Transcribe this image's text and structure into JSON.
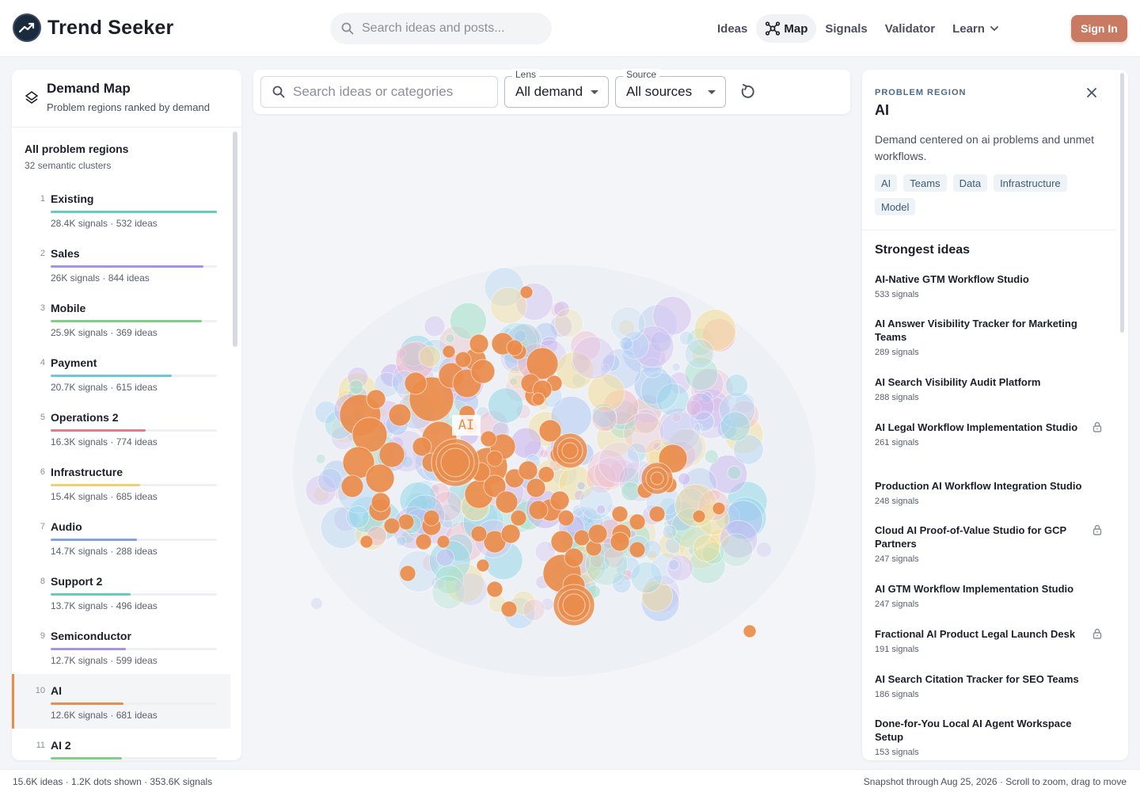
{
  "app": {
    "title": "Trend Seeker"
  },
  "header": {
    "search_placeholder": "Search ideas and posts...",
    "nav": [
      {
        "label": "Ideas",
        "active": false
      },
      {
        "label": "Map",
        "active": true,
        "icon": "graph-nodes-icon"
      },
      {
        "label": "Signals",
        "active": false
      },
      {
        "label": "Validator",
        "active": false
      },
      {
        "label": "Learn",
        "active": false,
        "icon": "chevron-down-icon"
      }
    ],
    "sign_in": "Sign In",
    "accent": "#c97a62"
  },
  "left_panel": {
    "title": "Demand Map",
    "subtitle": "Problem regions ranked by demand",
    "all_title": "All problem regions",
    "all_sub": "32 semantic clusters",
    "items": [
      {
        "rank": "1",
        "name": "Existing",
        "meta": "28.4K signals · 532 ideas",
        "bar": 1.0,
        "color": "#66cdb8",
        "active": false
      },
      {
        "rank": "2",
        "name": "Sales",
        "meta": "26K signals · 844 ideas",
        "bar": 0.92,
        "color": "#a793e0",
        "active": false
      },
      {
        "rank": "3",
        "name": "Mobile",
        "meta": "25.9K signals · 369 ideas",
        "bar": 0.91,
        "color": "#7fcf8a",
        "active": false
      },
      {
        "rank": "4",
        "name": "Payment",
        "meta": "20.7K signals · 615 ideas",
        "bar": 0.73,
        "color": "#6ec8d8",
        "active": false
      },
      {
        "rank": "5",
        "name": "Operations 2",
        "meta": "16.3K signals · 774 ideas",
        "bar": 0.57,
        "color": "#dc7f86",
        "active": false
      },
      {
        "rank": "6",
        "name": "Infrastructure",
        "meta": "15.4K signals · 685 ideas",
        "bar": 0.54,
        "color": "#f0d16a",
        "active": false
      },
      {
        "rank": "7",
        "name": "Audio",
        "meta": "14.7K signals · 288 ideas",
        "bar": 0.52,
        "color": "#7fa2e6",
        "active": false
      },
      {
        "rank": "8",
        "name": "Support 2",
        "meta": "13.7K signals · 496 ideas",
        "bar": 0.48,
        "color": "#66cdb8",
        "active": false
      },
      {
        "rank": "9",
        "name": "Semiconductor",
        "meta": "12.7K signals · 599 ideas",
        "bar": 0.45,
        "color": "#a793e0",
        "active": false
      },
      {
        "rank": "10",
        "name": "AI",
        "meta": "12.6K signals · 681 ideas",
        "bar": 0.44,
        "color": "#ea8c4b",
        "active": true
      },
      {
        "rank": "11",
        "name": "AI 2",
        "meta": "",
        "bar": 0.43,
        "color": "#7fcf8a",
        "active": false
      }
    ]
  },
  "toolbar": {
    "search_placeholder": "Search ideas or categories",
    "lens_label": "Lens",
    "lens_value": "All demand",
    "source_label": "Source",
    "source_value": "All sources"
  },
  "map": {
    "region_label": "AI",
    "highlight_color": "#ea8c4b"
  },
  "right_panel": {
    "eyebrow": "PROBLEM REGION",
    "title": "AI",
    "description": "Demand centered on ai problems and unmet workflows.",
    "tags": [
      "AI",
      "Teams",
      "Data",
      "Infrastructure",
      "Model"
    ],
    "ideas_heading": "Strongest ideas",
    "ideas": [
      {
        "title": "AI-Native GTM Workflow Studio",
        "signals": "533 signals",
        "locked": false
      },
      {
        "title": "AI Answer Visibility Tracker for Marketing Teams",
        "signals": "289 signals",
        "locked": false
      },
      {
        "title": "AI Search Visibility Audit Platform",
        "signals": "288 signals",
        "locked": false
      },
      {
        "title": "AI Legal Workflow Implementation Studio",
        "signals": "261 signals",
        "locked": true
      },
      {
        "title": "Production AI Workflow Integration Studio",
        "signals": "248 signals",
        "locked": false
      },
      {
        "title": "Cloud AI Proof-of-Value Studio for GCP Partners",
        "signals": "247 signals",
        "locked": true
      },
      {
        "title": "AI GTM Workflow Implementation Studio",
        "signals": "247 signals",
        "locked": false
      },
      {
        "title": "Fractional AI Product Legal Launch Desk",
        "signals": "191 signals",
        "locked": true
      },
      {
        "title": "AI Search Citation Tracker for SEO Teams",
        "signals": "186 signals",
        "locked": false
      },
      {
        "title": "Done-for-You Local AI Agent Workspace Setup",
        "signals": "153 signals",
        "locked": false
      }
    ]
  },
  "footer": {
    "stats": "15.6K ideas · 1.2K dots shown · 353.6K signals",
    "hint": "Snapshot through Aug 25, 2026 · Scroll to zoom, drag to move"
  }
}
